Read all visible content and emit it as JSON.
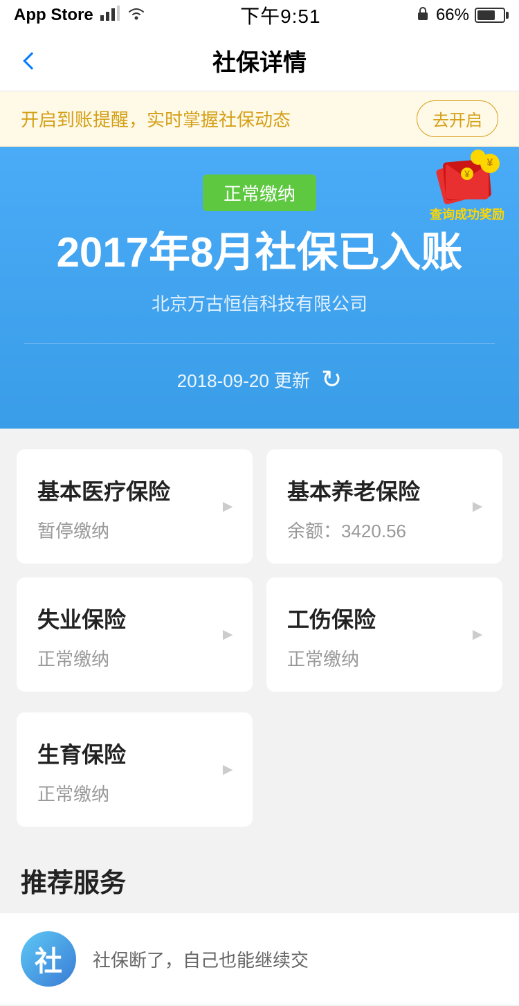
{
  "statusBar": {
    "carrier": "App Store",
    "signal": "●●●",
    "wifi": "wifi",
    "time": "下午9:51",
    "battery": "66%"
  },
  "navBar": {
    "backLabel": "<",
    "title": "社保详情"
  },
  "banner": {
    "text": "开启到账提醒，实时掌握社保动态",
    "buttonLabel": "去开启"
  },
  "mainCard": {
    "statusBadge": "正常缴纳",
    "mainTitle": "2017年8月社保已入账",
    "companyName": "北京万古恒信科技有限公司",
    "updateDate": "2018-09-20 更新",
    "refreshIcon": "↻",
    "rewardText": "查询成功奖励"
  },
  "insuranceItems": [
    {
      "title": "基本医疗保险",
      "status": "暂停缴纳",
      "balance": null
    },
    {
      "title": "基本养老保险",
      "status": "余额：3420.56",
      "balance": "3420.56"
    },
    {
      "title": "失业保险",
      "status": "正常缴纳",
      "balance": null
    },
    {
      "title": "工伤保险",
      "status": "正常缴纳",
      "balance": null
    },
    {
      "title": "生育保险",
      "status": "正常缴纳",
      "balance": null
    }
  ],
  "recommendSection": {
    "heading": "推荐服务",
    "items": [
      {
        "iconLabel": "社",
        "text": "社保断了，自己也能继续交"
      }
    ]
  }
}
